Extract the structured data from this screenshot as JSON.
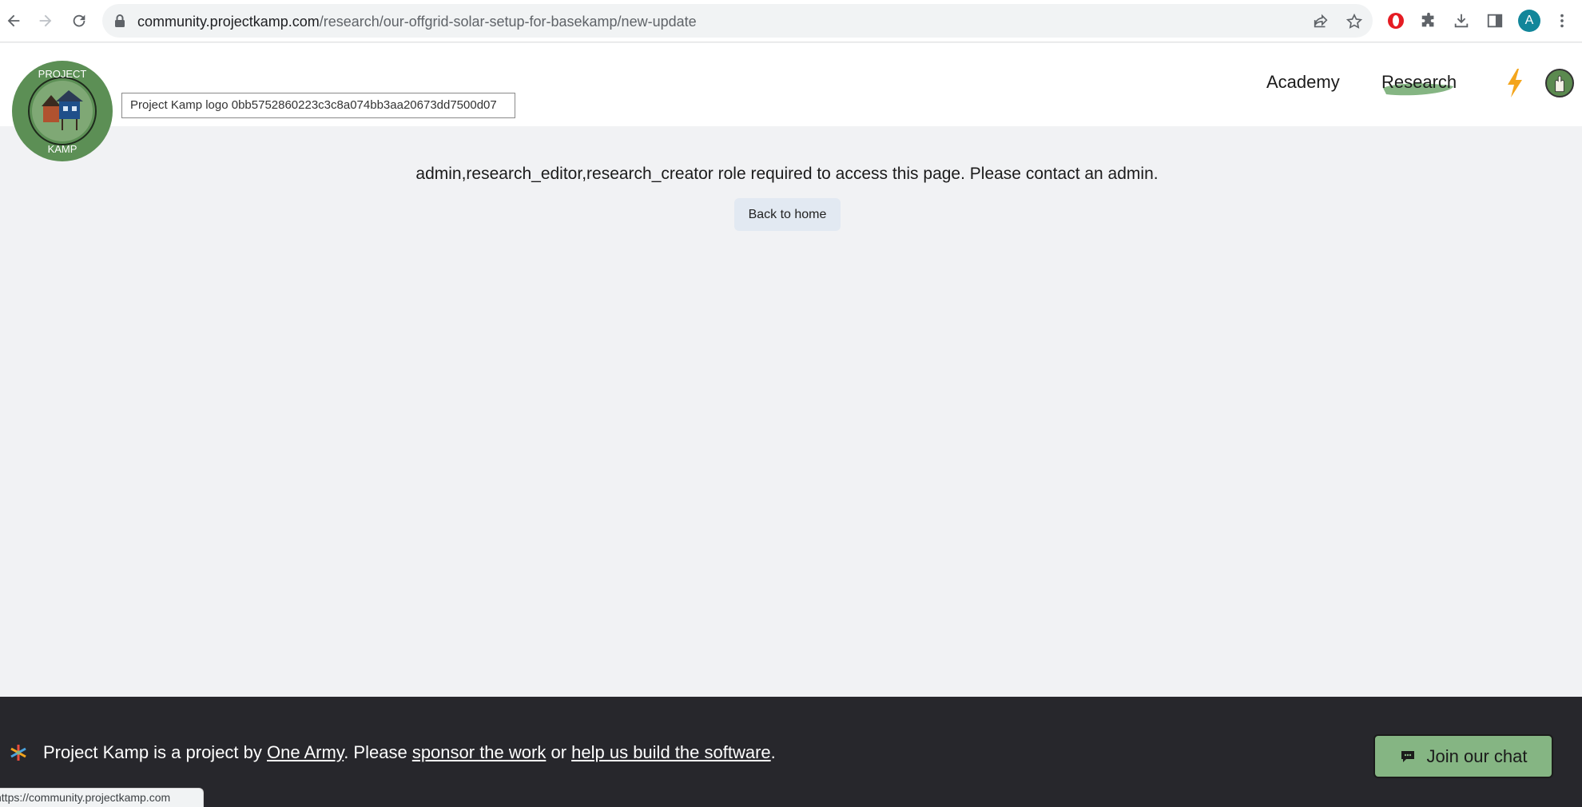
{
  "browser": {
    "url_domain": "community.projectkamp.com",
    "url_path": "/research/our-offgrid-solar-setup-for-basekamp/new-update",
    "profile_initial": "A",
    "status_url": "https://community.projectkamp.com"
  },
  "header": {
    "logo_top_text": "PROJECT",
    "logo_bottom_text": "KAMP",
    "logo_alt": "Project Kamp logo 0bb5752860223c3c8a074bb3aa20673dd7500d07",
    "nav": {
      "academy": "Academy",
      "research": "Research"
    }
  },
  "main": {
    "message": "admin,research_editor,research_creator role required to access this page. Please contact an admin.",
    "back_button": "Back to home"
  },
  "footer": {
    "text_1": "Project Kamp is a project by ",
    "link_one_army": "One Army",
    "text_2": ". Please ",
    "link_sponsor": "sponsor the work",
    "text_3": " or ",
    "link_help": "help us build the software",
    "text_4": ".",
    "chat_button": "Join our chat"
  },
  "colors": {
    "accent_green": "#85b583",
    "footer_bg": "#27272c",
    "page_bg": "#f1f2f4",
    "bolt": "#f4a51c"
  }
}
